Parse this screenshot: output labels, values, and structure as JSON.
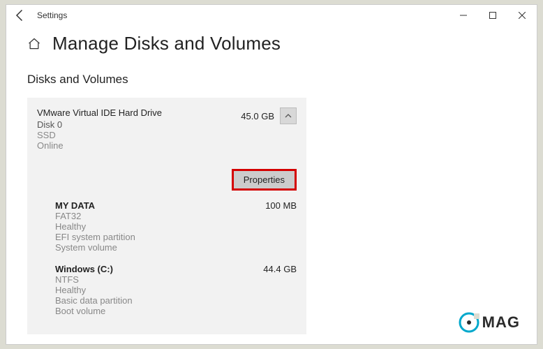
{
  "window": {
    "title": "Settings"
  },
  "heading": "Manage Disks and Volumes",
  "section_title": "Disks and Volumes",
  "disk": {
    "name": "VMware Virtual IDE Hard Drive",
    "id": "Disk 0",
    "type": "SSD",
    "status": "Online",
    "size": "45.0 GB"
  },
  "buttons": {
    "properties": "Properties"
  },
  "volumes": [
    {
      "name": "MY DATA",
      "fs": "FAT32",
      "health": "Healthy",
      "ptype": "EFI system partition",
      "role": "System volume",
      "size": "100 MB"
    },
    {
      "name": "Windows (C:)",
      "fs": "NTFS",
      "health": "Healthy",
      "ptype": "Basic data partition",
      "role": "Boot volume",
      "size": "44.4 GB"
    }
  ],
  "watermark": "MAG"
}
